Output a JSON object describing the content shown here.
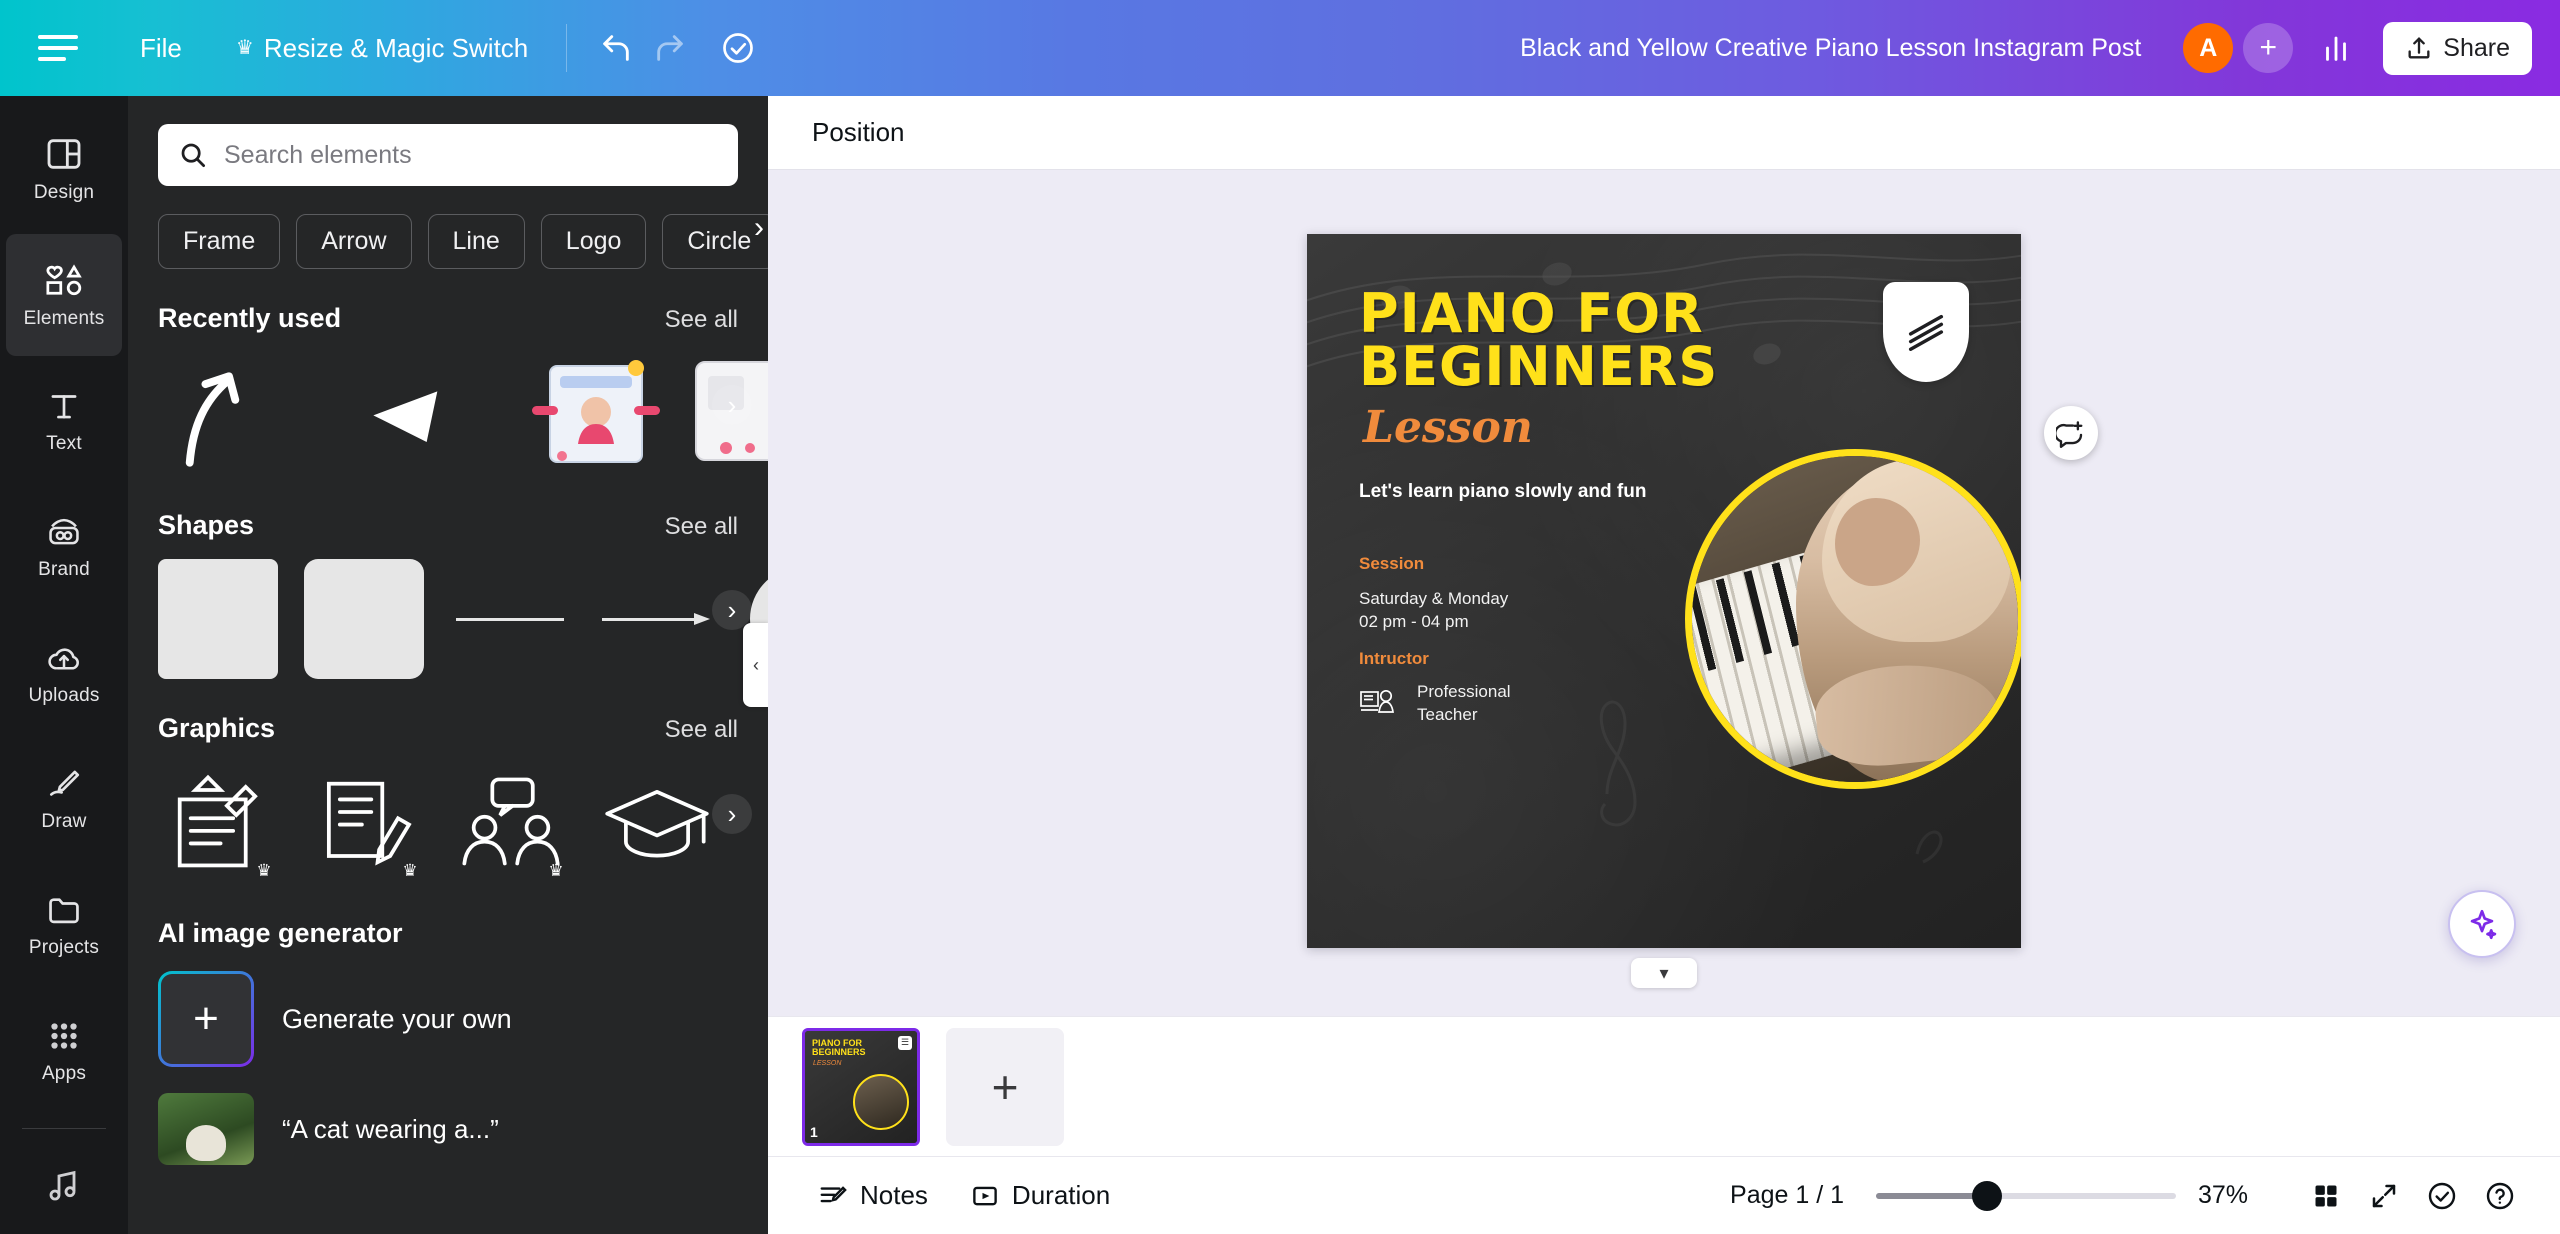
{
  "topbar": {
    "menu_hamburger": "menu",
    "file_label": "File",
    "resize_label": "Resize & Magic Switch",
    "crown": "♛",
    "doc_title": "Black and Yellow Creative Piano Lesson Instagram Post",
    "avatar_initial": "A",
    "plus_label": "+",
    "share_label": "Share",
    "icons": [
      "undo-icon",
      "redo-icon",
      "cloud-check-icon",
      "insights-icon",
      "upload-icon"
    ]
  },
  "rail": {
    "items": [
      {
        "label": "Design",
        "icon": "design-icon",
        "active": false
      },
      {
        "label": "Elements",
        "icon": "elements-icon",
        "active": true
      },
      {
        "label": "Text",
        "icon": "text-icon",
        "active": false
      },
      {
        "label": "Brand",
        "icon": "brand-icon",
        "active": false
      },
      {
        "label": "Uploads",
        "icon": "uploads-icon",
        "active": false
      },
      {
        "label": "Draw",
        "icon": "draw-icon",
        "active": false
      },
      {
        "label": "Projects",
        "icon": "projects-icon",
        "active": false
      },
      {
        "label": "Apps",
        "icon": "apps-icon",
        "active": false
      }
    ]
  },
  "panel": {
    "search_placeholder": "Search elements",
    "search_value": "",
    "chips": [
      "Frame",
      "Arrow",
      "Line",
      "Logo",
      "Circle"
    ],
    "sections": [
      {
        "title": "Recently used",
        "see_all": "See all"
      },
      {
        "title": "Shapes",
        "see_all": "See all"
      },
      {
        "title": "Graphics",
        "see_all": "See all"
      }
    ],
    "ai": {
      "title": "AI image generator",
      "generate_label": "Generate your own",
      "quote": "“A cat wearing a...”"
    }
  },
  "context_bar": {
    "position_label": "Position"
  },
  "design": {
    "title_line1": "PIANO FOR",
    "title_line2": "BEGINNERS",
    "script_word": "Lesson",
    "tagline": "Let's learn piano slowly and fun",
    "session_label": "Session",
    "session_days": "Saturday & Monday",
    "session_time": "02 pm - 04 pm",
    "instructor_label": "Intructor",
    "instructor_line1": "Professional",
    "instructor_line2": "Teacher",
    "colors": {
      "yellow": "#ffe11a",
      "orange": "#f08b3c",
      "bg": "#2b2b2b"
    }
  },
  "pages": {
    "thumb_title": "PIANO FOR BEGINNERS",
    "thumb_sub": "LESSON",
    "thumb_number": "1",
    "add_label": "+"
  },
  "bottombar": {
    "notes_label": "Notes",
    "duration_label": "Duration",
    "page_count": "Page 1 / 1",
    "zoom_value": "37%",
    "zoom_percent": 37,
    "icons": [
      "grid-view-icon",
      "fullscreen-icon",
      "check-circle-icon",
      "help-icon"
    ]
  }
}
